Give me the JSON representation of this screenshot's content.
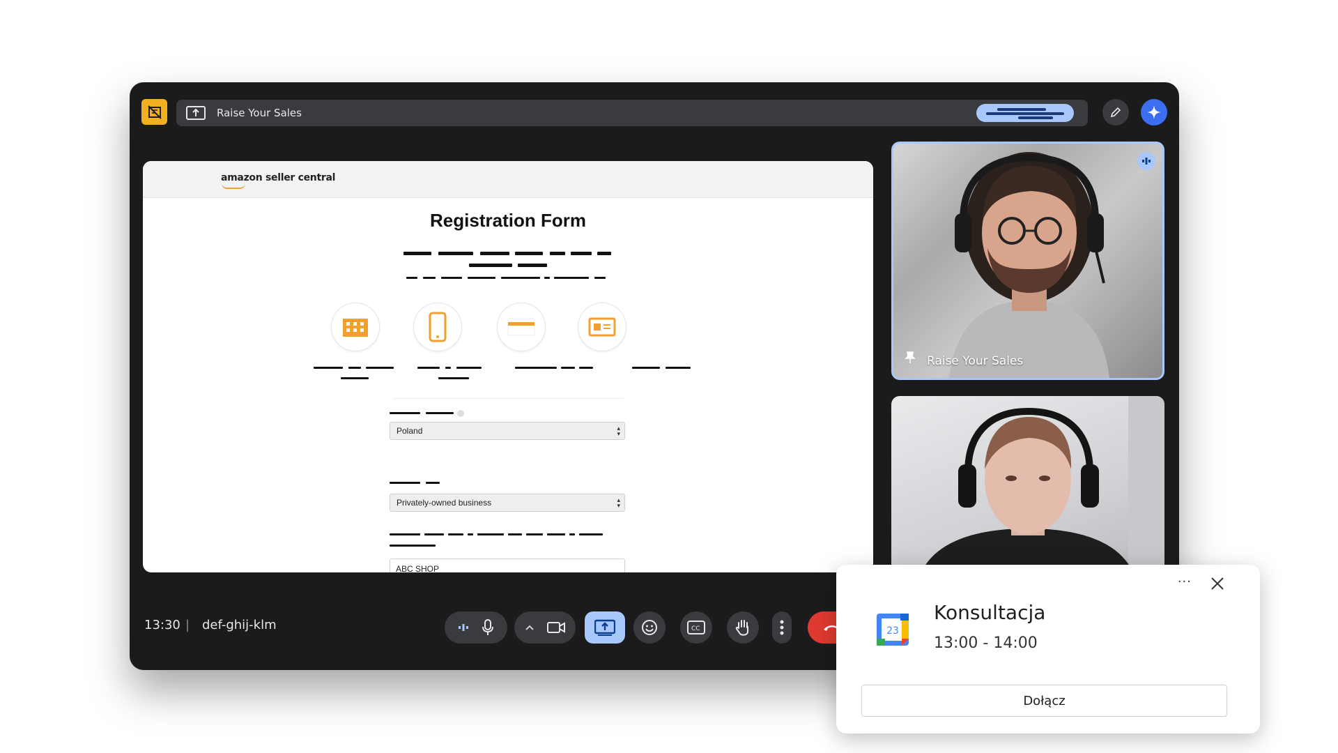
{
  "window": {
    "title": "Raise Your Sales",
    "colors": {
      "accent": "#a8c7fa",
      "logo": "#f2b01e",
      "gemini": "#3b6ef0",
      "end_call": "#e03a30"
    }
  },
  "slide": {
    "brand": "amazon seller central",
    "heading": "Registration Form",
    "country_value": "Poland",
    "business_type_value": "Privately-owned business",
    "business_name_value": "ABC SHOP",
    "step_icons": [
      "building-icon",
      "phone-icon",
      "credit-card-icon",
      "id-card-icon"
    ]
  },
  "participants": [
    {
      "name": "Raise Your Sales",
      "pinned": true,
      "speaking": true
    },
    {
      "name": "",
      "pinned": false,
      "speaking": false
    }
  ],
  "meeting": {
    "time": "13:30",
    "separator": "|",
    "code": "def-ghij-klm"
  },
  "controls": [
    "audio-level-icon",
    "microphone-icon",
    "chevron-up-icon",
    "camera-icon",
    "present-screen-icon",
    "emoji-icon",
    "captions-icon",
    "raise-hand-icon",
    "more-vert-icon",
    "end-call-icon"
  ],
  "notification": {
    "more": "···",
    "calendar_day": "23",
    "title": "Konsultacja",
    "time_range": "13:00 - 14:00",
    "join_label": "Dołącz"
  }
}
